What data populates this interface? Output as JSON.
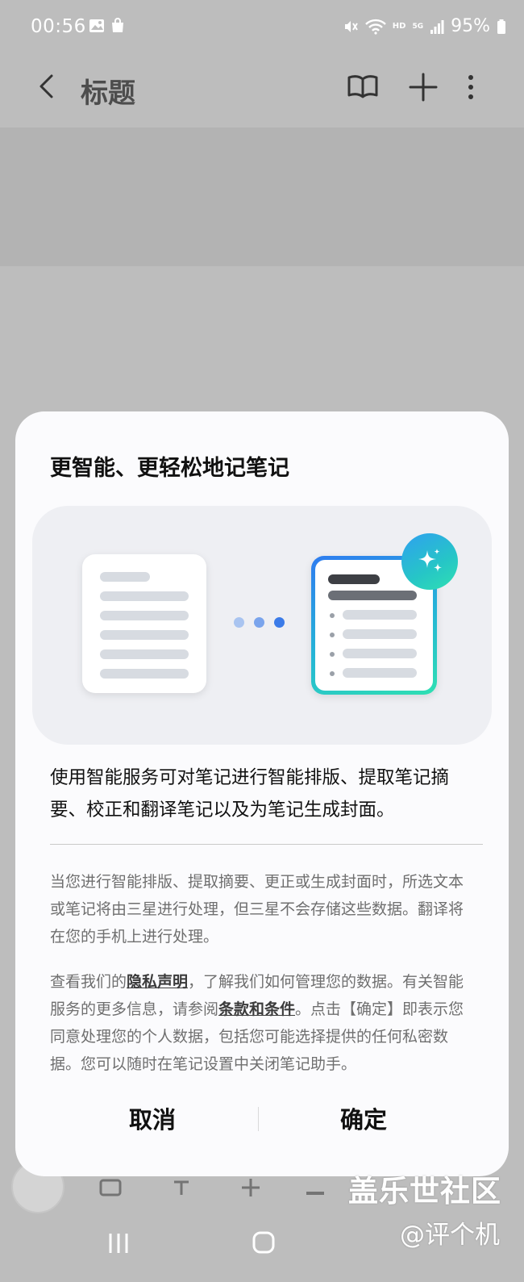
{
  "status_bar": {
    "time": "00:56",
    "battery": "95%",
    "network_hd": "HD",
    "network_5g": "5G"
  },
  "app_bar": {
    "title": "标题",
    "icons": [
      "back-icon",
      "book-icon",
      "plus-icon",
      "more-icon"
    ]
  },
  "dialog": {
    "title": "更智能、更轻松地记笔记",
    "intro": "使用智能服务可对笔记进行智能排版、提取笔记摘要、校正和翻译笔记以及为笔记生成封面。",
    "detail1": "当您进行智能排版、提取摘要、更正或生成封面时，所选文本或笔记将由三星进行处理，但三星不会存储这些数据。翻译将在您的手机上进行处理。",
    "detail2": {
      "part1": "查看我们的",
      "privacy_link": "隐私声明",
      "part2": "，了解我们如何管理您的数据。有关智能服务的更多信息，请参阅",
      "terms_link": "条款和条件",
      "part3": "。点击【确定】即表示您同意处理您的个人数据，包括您可能选择提供的任何私密数据。您可以随时在笔记设置中关闭笔记助手。"
    },
    "cancel_label": "取消",
    "ok_label": "确定"
  },
  "colors": {
    "accent_blue": "#3b7be8",
    "dot_light": "#a9c4f0",
    "dot_mid": "#7aa4ec",
    "gradient_teal": "#2fe0b2"
  },
  "watermark": {
    "line1": "盖乐世社区",
    "line2": "@评个机"
  }
}
